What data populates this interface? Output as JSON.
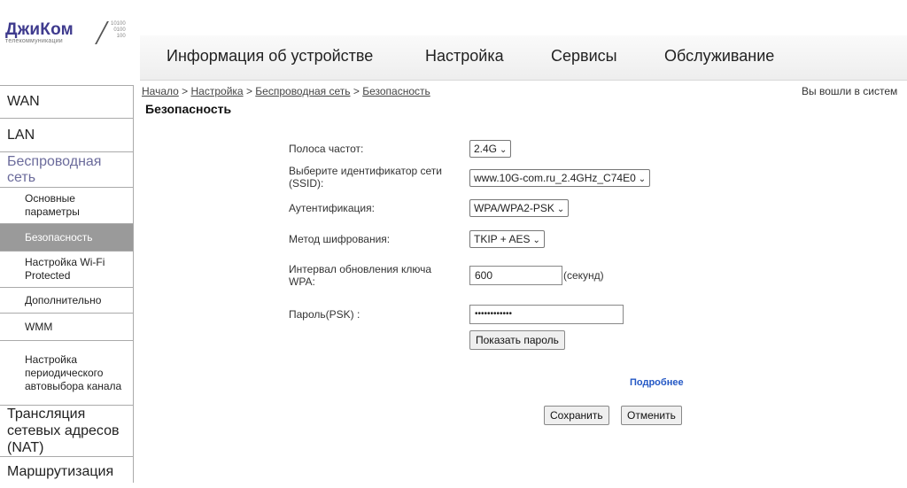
{
  "logo": {
    "brand": "ДжиКом",
    "tagline": "телекоммуникации",
    "digits": [
      "10100",
      "0100",
      "100"
    ]
  },
  "topnav": [
    "Информация об устройстве",
    "Настройка",
    "Сервисы",
    "Обслуживание"
  ],
  "sidebar": [
    {
      "label": "WAN",
      "level": "top"
    },
    {
      "label": "LAN",
      "level": "top"
    },
    {
      "label": "Беспроводная сеть",
      "level": "top",
      "active": true
    },
    {
      "label": "Основные параметры",
      "level": "sub"
    },
    {
      "label": "Безопасность",
      "level": "sub",
      "selected": true
    },
    {
      "label": "Настройка Wi-Fi Protected",
      "level": "sub"
    },
    {
      "label": "Дополнительно",
      "level": "sub"
    },
    {
      "label": "WMM",
      "level": "sub"
    },
    {
      "label": "Настройка периодического автовыбора канала",
      "level": "sub"
    },
    {
      "label": "Трансляция сетевых адресов (NAT)",
      "level": "top"
    },
    {
      "label": "Маршрутизация",
      "level": "top"
    }
  ],
  "breadcrumb": {
    "home": "Начало",
    "sep": ">",
    "settings": "Настройка",
    "wireless": "Беспроводная сеть",
    "security": "Безопасность"
  },
  "logged_in": "Вы вошли в систем",
  "page_title": "Безопасность",
  "form": {
    "band_label": "Полоса частот:",
    "band_value": "2.4G",
    "ssid_label": "Выберите идентификатор сети (SSID):",
    "ssid_value": "www.10G-com.ru_2.4GHz_C74E0",
    "auth_label": "Аутентификация:",
    "auth_value": "WPA/WPA2-PSK",
    "enc_label": "Метод шифрования:",
    "enc_value": "TKIP + AES",
    "interval_label": "Интервал обновления ключа WPA:",
    "interval_value": "600",
    "interval_unit": "(секунд)",
    "psk_label": "Пароль(PSK) :",
    "psk_value": "••••••••••••",
    "show_password": "Показать пароль",
    "more": "Подробнее",
    "save": "Сохранить",
    "cancel": "Отменить"
  }
}
